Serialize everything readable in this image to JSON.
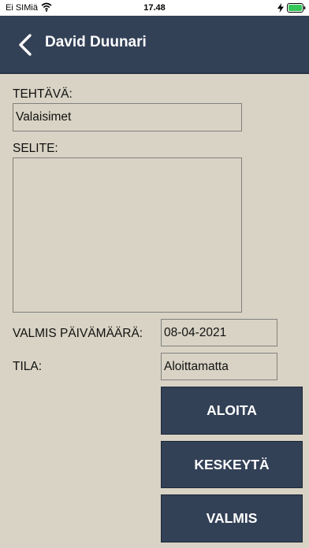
{
  "status_bar": {
    "carrier": "Ei SIMiä",
    "time": "17.48"
  },
  "header": {
    "title": "David Duunari",
    "back_icon": "chevron-left-icon"
  },
  "form": {
    "task_label": "TEHTÄVÄ:",
    "task_value": "Valaisimet",
    "description_label": "SELITE:",
    "description_value": "",
    "due_date_label": "VALMIS PÄIVÄMÄÄRÄ:",
    "due_date_value": "08-04-2021",
    "status_label": "TILA:",
    "status_value": "Aloittamatta"
  },
  "actions": {
    "start": "ALOITA",
    "pause": "KESKEYTÄ",
    "done": "VALMIS"
  },
  "colors": {
    "header_bg": "#334157",
    "page_bg": "#d8d3c4",
    "button_bg": "#334157"
  }
}
